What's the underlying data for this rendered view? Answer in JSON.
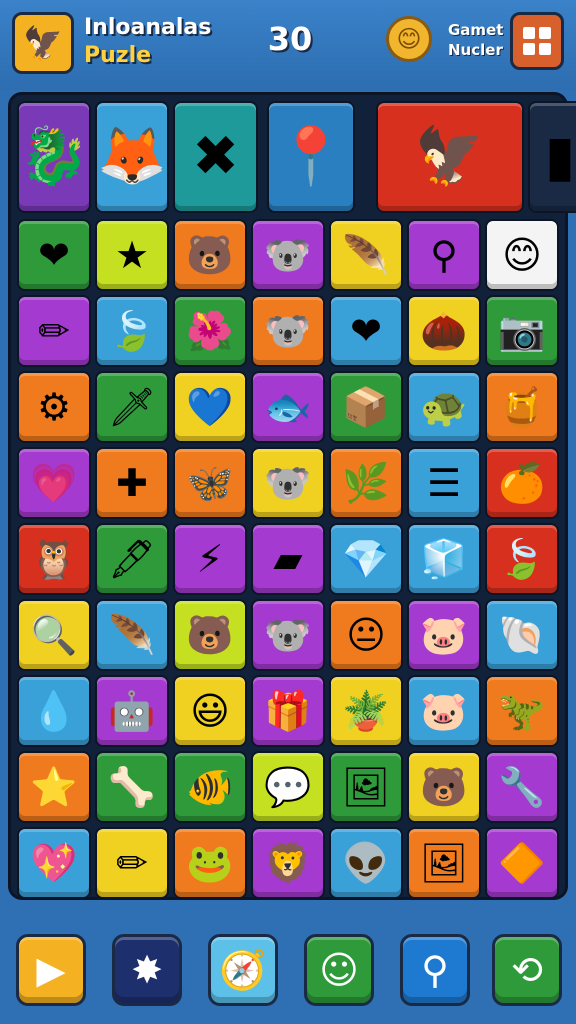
{
  "header": {
    "logo_icon": "eagle-emblem-icon",
    "title_line1": "Inloanalas",
    "title_line2": "Puzle",
    "score": "30",
    "coin_icon": "coin-face-icon",
    "game_label_line1": "Gamet",
    "game_label_line2": "Nucler",
    "menu_icon": "grid-menu-icon"
  },
  "colors": {
    "background": "#2f6fb3",
    "board": "#12213a",
    "accent_yellow": "#ffd23d",
    "menu_orange": "#d8602c"
  },
  "board": {
    "rows": 10,
    "cols": 7,
    "special_tiles": [
      {
        "name": "fox-tile",
        "icon": "fox-icon",
        "glyph": "🦊",
        "color": "#3aa0d8"
      },
      {
        "name": "star-x-tile",
        "icon": "star-x-icon",
        "glyph": "✖",
        "color": "#1e9a9a"
      },
      {
        "name": "pin-tile",
        "icon": "smiley-pin-icon",
        "glyph": "📍",
        "color": "#2a7fc0"
      },
      {
        "name": "eagle-tile",
        "icon": "golden-eagle-icon",
        "glyph": "🦅",
        "color": "#d8301e"
      },
      {
        "name": "cylinder-tile",
        "icon": "blue-cylinder-icon",
        "glyph": "▮",
        "color": "#1a2a44"
      }
    ],
    "first_tile": {
      "icon": "seahorse-heart-icon",
      "glyph": "🐉",
      "color": "#7a3ab8"
    },
    "grid": [
      [
        {
          "icon": "heart-icon",
          "glyph": "❤",
          "color": "#2e9a3a"
        },
        {
          "icon": "star-icon",
          "glyph": "★",
          "color": "#c4e020"
        },
        {
          "icon": "bear-face-icon",
          "glyph": "🐻",
          "color": "#f07a1e"
        },
        {
          "icon": "gray-bear-icon",
          "glyph": "🐨",
          "color": "#a43ad0"
        },
        {
          "icon": "feather-icon",
          "glyph": "🪶",
          "color": "#f0d020"
        },
        {
          "icon": "key-icon",
          "glyph": "⚲",
          "color": "#a43ad0"
        },
        {
          "icon": "smiley-icon",
          "glyph": "😊",
          "color": "#f4f4f4"
        }
      ],
      [
        {
          "icon": "pencil-icon",
          "glyph": "✏",
          "color": "#a43ad0"
        },
        {
          "icon": "leaf-icon",
          "glyph": "🍃",
          "color": "#3aa0d8"
        },
        {
          "icon": "flower-icon",
          "glyph": "🌺",
          "color": "#2e9a3a"
        },
        {
          "icon": "gray-bear-icon",
          "glyph": "🐨",
          "color": "#f07a1e"
        },
        {
          "icon": "heart-icon",
          "glyph": "❤",
          "color": "#3aa0d8"
        },
        {
          "icon": "seed-icon",
          "glyph": "🌰",
          "color": "#f0d020"
        },
        {
          "icon": "camera-icon",
          "glyph": "📷",
          "color": "#2e9a3a"
        }
      ],
      [
        {
          "icon": "gear-icon",
          "glyph": "⚙",
          "color": "#f07a1e"
        },
        {
          "icon": "sword-icon",
          "glyph": "🗡",
          "color": "#2e9a3a"
        },
        {
          "icon": "heart-icon",
          "glyph": "💙",
          "color": "#f0d020"
        },
        {
          "icon": "fish-icon",
          "glyph": "🐟",
          "color": "#a43ad0"
        },
        {
          "icon": "box-icon",
          "glyph": "📦",
          "color": "#2e9a3a"
        },
        {
          "icon": "turtle-icon",
          "glyph": "🐢",
          "color": "#3aa0d8"
        },
        {
          "icon": "bottle-icon",
          "glyph": "🍯",
          "color": "#f07a1e"
        }
      ],
      [
        {
          "icon": "heart-icon",
          "glyph": "💗",
          "color": "#a43ad0"
        },
        {
          "icon": "plus-box-icon",
          "glyph": "✚",
          "color": "#f07a1e"
        },
        {
          "icon": "wing-icon",
          "glyph": "🦋",
          "color": "#f07a1e"
        },
        {
          "icon": "gray-bear-icon",
          "glyph": "🐨",
          "color": "#f0d020"
        },
        {
          "icon": "twig-icon",
          "glyph": "🌿",
          "color": "#f07a1e"
        },
        {
          "icon": "window-icon",
          "glyph": "☰",
          "color": "#3aa0d8"
        },
        {
          "icon": "fruit-icon",
          "glyph": "🍊",
          "color": "#d8301e"
        }
      ],
      [
        {
          "icon": "owl-face-icon",
          "glyph": "🦉",
          "color": "#d8301e"
        },
        {
          "icon": "pen-icon",
          "glyph": "🖋",
          "color": "#2e9a3a"
        },
        {
          "icon": "claw-icon",
          "glyph": "⚡",
          "color": "#a43ad0"
        },
        {
          "icon": "block-icon",
          "glyph": "▰",
          "color": "#a43ad0"
        },
        {
          "icon": "gem-icon",
          "glyph": "💎",
          "color": "#3aa0d8"
        },
        {
          "icon": "cube-icon",
          "glyph": "🧊",
          "color": "#3aa0d8"
        },
        {
          "icon": "leaf-icon",
          "glyph": "🍃",
          "color": "#d8301e"
        }
      ],
      [
        {
          "icon": "search-bubble-icon",
          "glyph": "🔍",
          "color": "#f0d020"
        },
        {
          "icon": "feather-icon",
          "glyph": "🪶",
          "color": "#3aa0d8"
        },
        {
          "icon": "bear-face-icon",
          "glyph": "🐻",
          "color": "#c4e020"
        },
        {
          "icon": "gray-bear-icon",
          "glyph": "🐨",
          "color": "#a43ad0"
        },
        {
          "icon": "neutral-face-icon",
          "glyph": "😐",
          "color": "#f07a1e"
        },
        {
          "icon": "pig-face-icon",
          "glyph": "🐷",
          "color": "#a43ad0"
        },
        {
          "icon": "shell-icon",
          "glyph": "🐚",
          "color": "#3aa0d8"
        }
      ],
      [
        {
          "icon": "drop-icon",
          "glyph": "💧",
          "color": "#3aa0d8"
        },
        {
          "icon": "robot-icon",
          "glyph": "🤖",
          "color": "#a43ad0"
        },
        {
          "icon": "smiley-icon",
          "glyph": "😃",
          "color": "#f0d020"
        },
        {
          "icon": "gift-face-icon",
          "glyph": "🎁",
          "color": "#a43ad0"
        },
        {
          "icon": "pot-icon",
          "glyph": "🪴",
          "color": "#f0d020"
        },
        {
          "icon": "pig-face-icon",
          "glyph": "🐷",
          "color": "#3aa0d8"
        },
        {
          "icon": "dino-icon",
          "glyph": "🦖",
          "color": "#f07a1e"
        }
      ],
      [
        {
          "icon": "star-icon",
          "glyph": "⭐",
          "color": "#f07a1e"
        },
        {
          "icon": "bone-icon",
          "glyph": "🦴",
          "color": "#2e9a3a"
        },
        {
          "icon": "fish-icon",
          "glyph": "🐠",
          "color": "#2e9a3a"
        },
        {
          "icon": "bubble-icon",
          "glyph": "💬",
          "color": "#c4e020"
        },
        {
          "icon": "frame-icon",
          "glyph": "🖼",
          "color": "#2e9a3a"
        },
        {
          "icon": "bear-face-icon",
          "glyph": "🐻",
          "color": "#f0d020"
        },
        {
          "icon": "pipe-icon",
          "glyph": "🔧",
          "color": "#a43ad0"
        }
      ],
      [
        {
          "icon": "heart-icon",
          "glyph": "💖",
          "color": "#3aa0d8"
        },
        {
          "icon": "pencil-icon",
          "glyph": "✏",
          "color": "#f0d020"
        },
        {
          "icon": "frog-icon",
          "glyph": "🐸",
          "color": "#f07a1e"
        },
        {
          "icon": "lion-face-icon",
          "glyph": "🦁",
          "color": "#a43ad0"
        },
        {
          "icon": "alien-icon",
          "glyph": "👽",
          "color": "#3aa0d8"
        },
        {
          "icon": "frame-icon",
          "glyph": "🖼",
          "color": "#f07a1e"
        },
        {
          "icon": "gem-icon",
          "glyph": "🔶",
          "color": "#a43ad0"
        }
      ]
    ]
  },
  "bottom_bar": [
    {
      "name": "play-button",
      "icon": "play-icon",
      "glyph": "▶",
      "color": "#f4b223"
    },
    {
      "name": "star-button",
      "icon": "star-icon",
      "glyph": "✸",
      "color": "#1e2f6e"
    },
    {
      "name": "compass-button",
      "icon": "compass-icon",
      "glyph": "🧭",
      "color": "#5cc0e8"
    },
    {
      "name": "face-button",
      "icon": "smiley-icon",
      "glyph": "☺",
      "color": "#2e9a3a"
    },
    {
      "name": "hint-button",
      "icon": "magnifier-icon",
      "glyph": "⚲",
      "color": "#1e7ad0"
    },
    {
      "name": "shuffle-button",
      "icon": "shuffle-icon",
      "glyph": "⟲",
      "color": "#2e9a3a"
    }
  ]
}
